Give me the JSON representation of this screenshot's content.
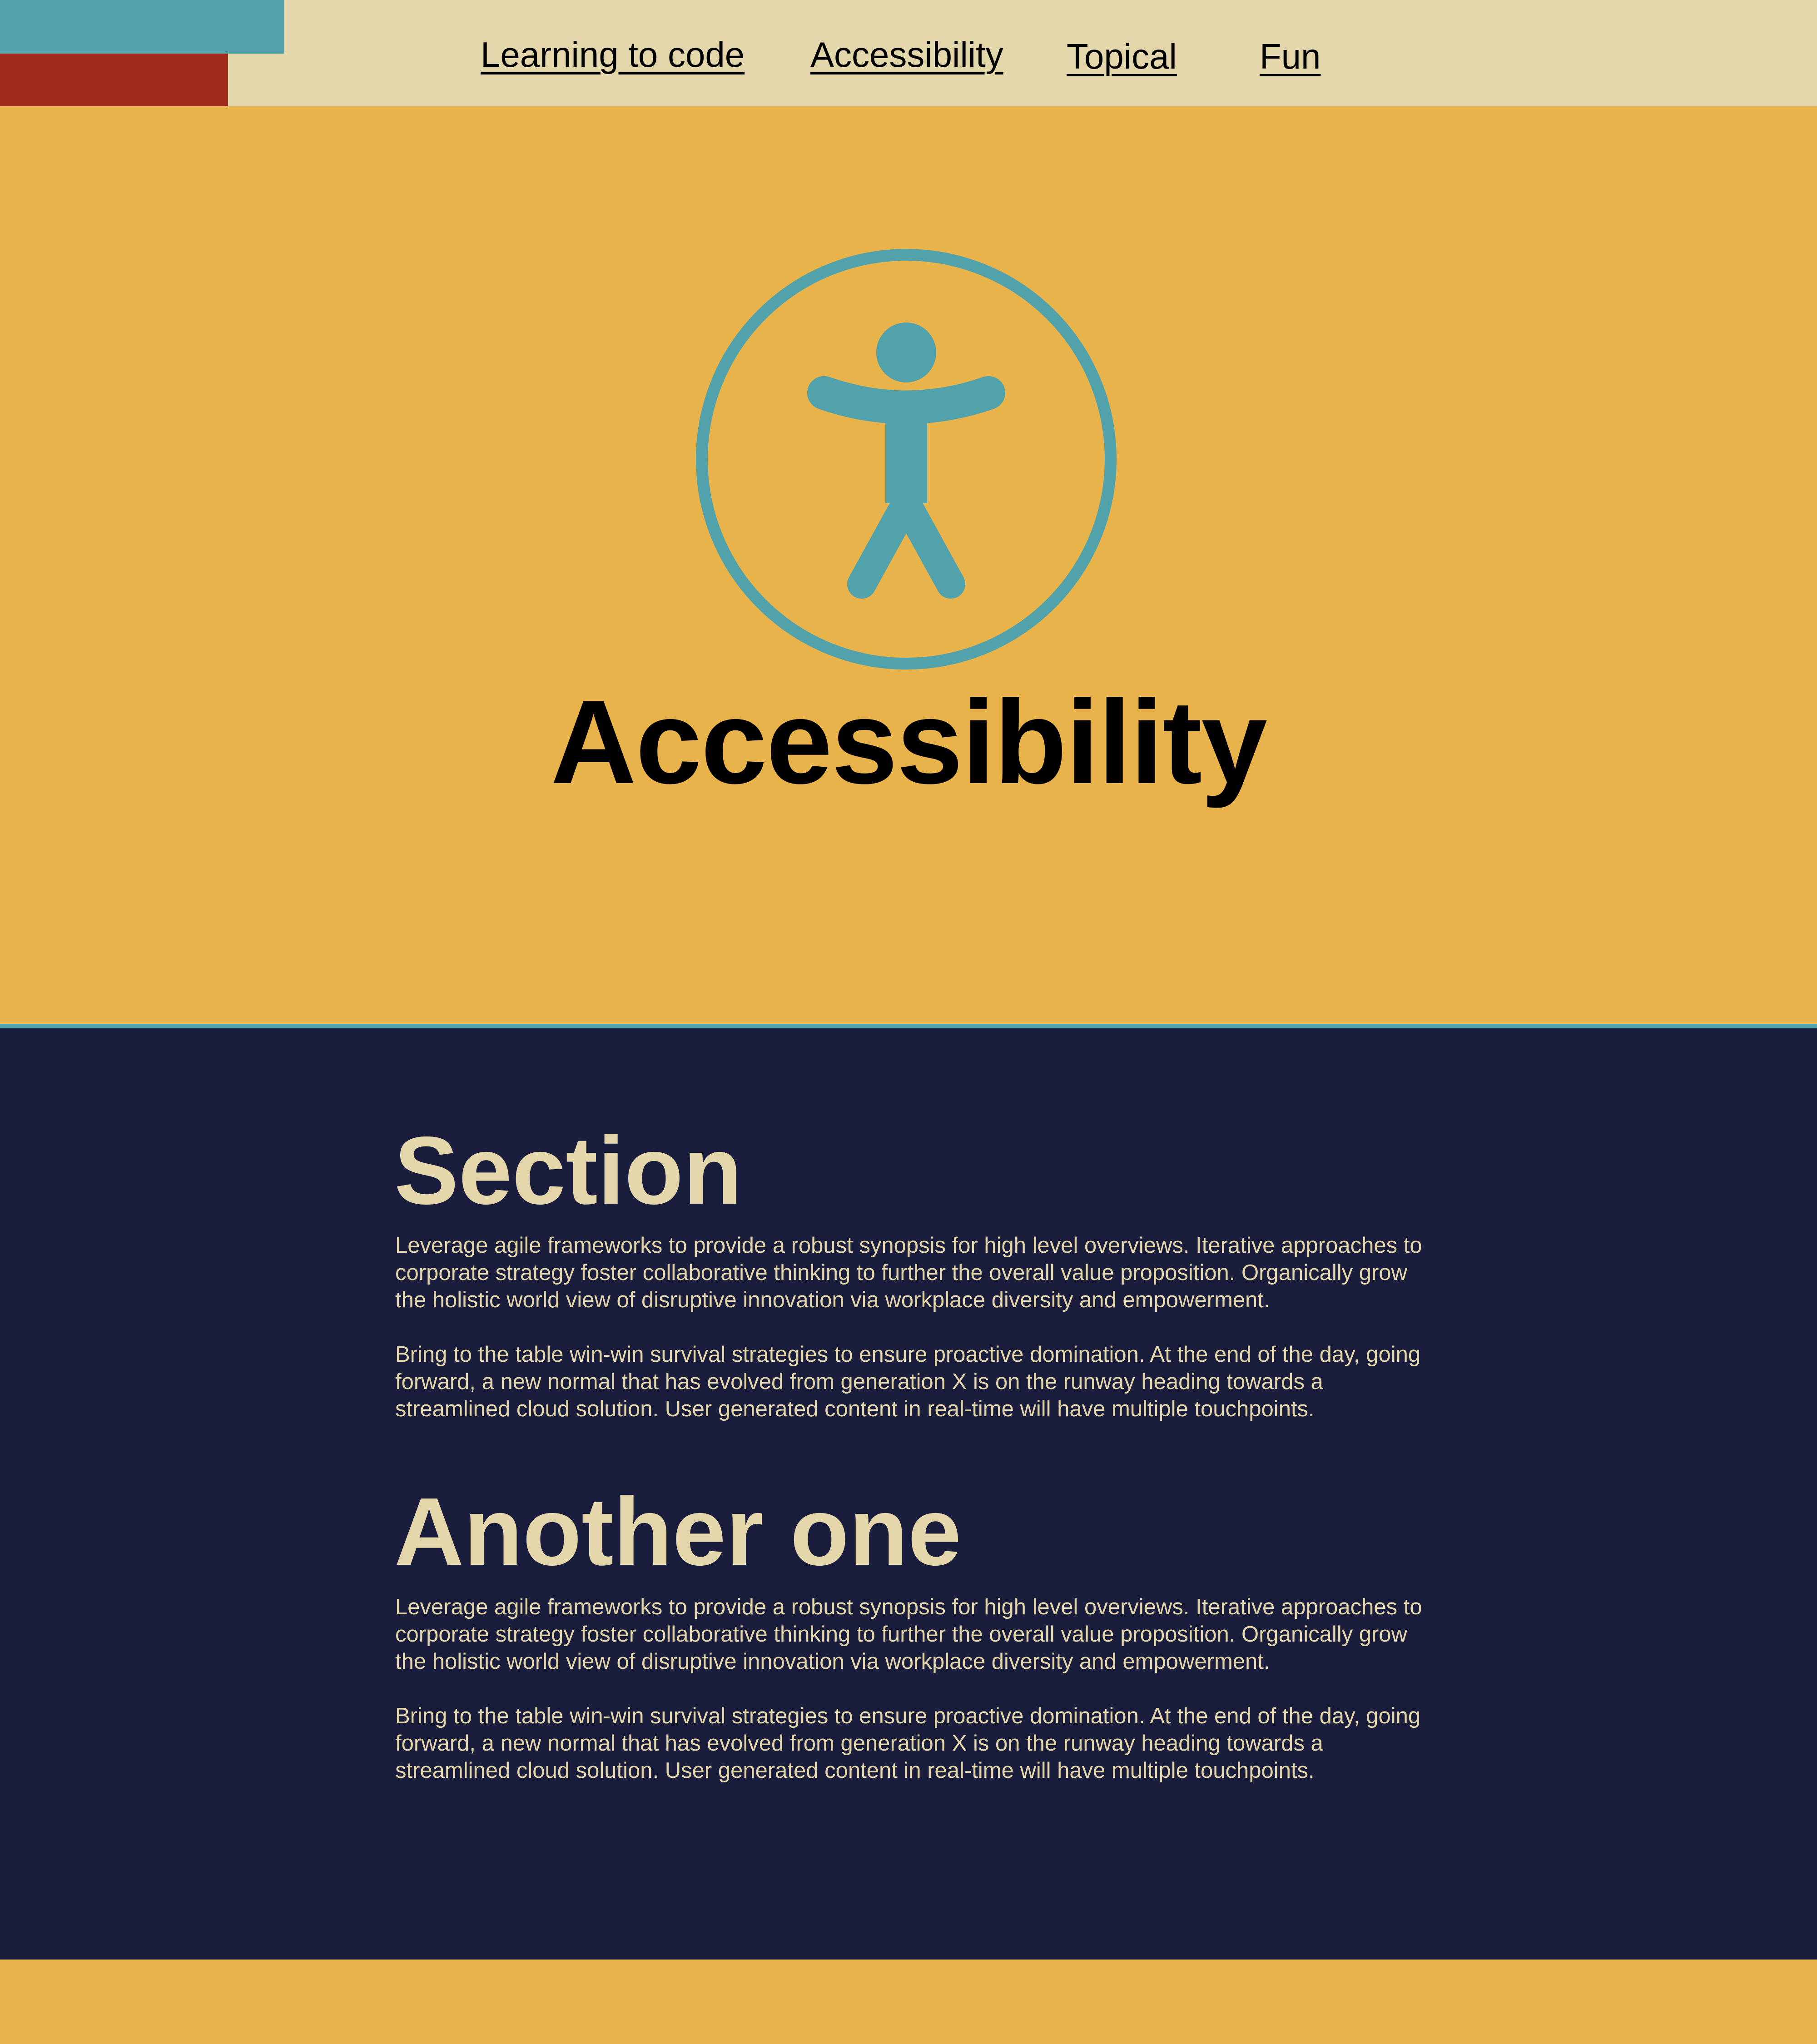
{
  "nav": {
    "links": [
      {
        "label": "Learning to code"
      },
      {
        "label": "Accessibility"
      },
      {
        "label": "Topical"
      },
      {
        "label": "Fun"
      }
    ]
  },
  "hero": {
    "icon": "accessibility-icon",
    "title": "Accessibility"
  },
  "sections": [
    {
      "heading": "Section",
      "paragraphs": [
        "Leverage agile frameworks to provide a robust synopsis for high level overviews. Iterative approaches to corporate strategy foster collaborative thinking to further the overall value proposition. Organically grow the holistic world view of disruptive innovation via workplace diversity and empowerment.",
        "Bring to the table win-win survival strategies to ensure proactive domination. At the end of the day, going forward, a new normal that has evolved from generation X is on the runway heading towards a streamlined cloud solution. User generated content in real-time will have multiple touchpoints."
      ]
    },
    {
      "heading": "Another one",
      "paragraphs": [
        "Leverage agile frameworks to provide a robust synopsis for high level overviews. Iterative approaches to corporate strategy foster collaborative thinking to further the overall value proposition. Organically grow the holistic world view of disruptive innovation via workplace diversity and empowerment.",
        "Bring to the table win-win survival strategies to ensure proactive domination. At the end of the day, going forward, a new normal that has evolved from generation X is on the runway heading towards a streamlined cloud solution. User generated content in real-time will have multiple touchpoints."
      ]
    }
  ],
  "colors": {
    "nav_background": "#e3d6aa",
    "logo_teal": "#51a2ab",
    "logo_red": "#9f2b1b",
    "hero_background": "#e8b34b",
    "content_background": "#1b1d3c",
    "content_text": "#e3d6aa"
  }
}
